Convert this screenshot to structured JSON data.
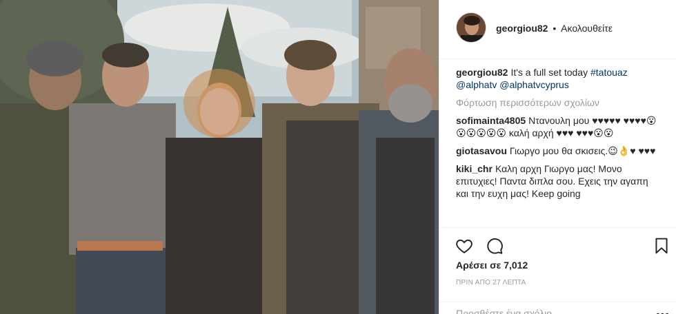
{
  "post": {
    "author": "georgiou82",
    "separator": "•",
    "follow_label": "Ακολουθείτε"
  },
  "caption": {
    "user": "georgiou82",
    "text": "It's a full set today",
    "hashtag": "#tatouaz",
    "mention1": "@alphatv",
    "mention2": "@alphatvcyprus"
  },
  "load_more_label": "Φόρτωση περισσότερων σχολίων",
  "comments": [
    {
      "user": "sofimainta4805",
      "text": "Ντανουλη μου ♥♥♥♥♥ ♥♥♥♥😮😮😮😮😮😮 καλή αρχή ♥♥♥ ♥♥♥😮😮"
    },
    {
      "user": "giotasavou",
      "text": "Γιωργο μου θα σκισεις.😉👌♥ ♥♥♥"
    },
    {
      "user": "kiki_chr",
      "text": "Καλη αρχη Γιωργο μας! Μονο επιτυχιες! Παντα διπλα σου. Εχεις την αγαπη και την ευχη μας! Keep going"
    }
  ],
  "likes_text": "Αρέσει σε 7,012",
  "time_text": "ΠΡΙΝ ΑΠΟ 27 ΛΕΠΤΑ",
  "add_comment_placeholder": "Προσθέστε ένα σχόλιο...",
  "more_label": "•••",
  "colors": {
    "text": "#262626",
    "link": "#003569",
    "muted": "#999999",
    "border": "#efefef"
  }
}
